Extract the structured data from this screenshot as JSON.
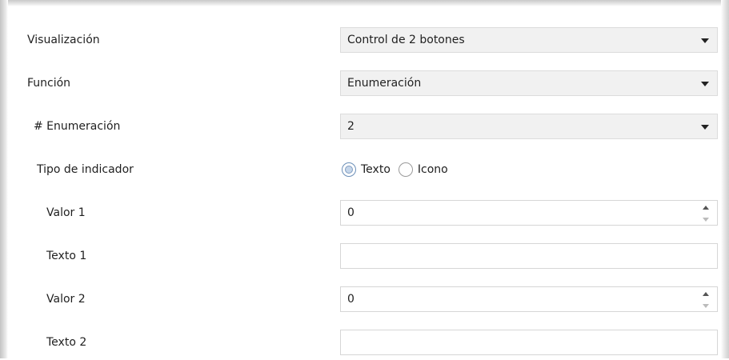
{
  "rows": {
    "visualizacion": {
      "label": "Visualización",
      "value": "Control de 2 botones"
    },
    "funcion": {
      "label": "Función",
      "value": "Enumeración"
    },
    "enumeracion": {
      "label": "# Enumeración",
      "value": "2"
    },
    "tipo_indicador": {
      "label": "Tipo de indicador",
      "options": [
        {
          "label": "Texto",
          "selected": true
        },
        {
          "label": "Icono",
          "selected": false
        }
      ]
    },
    "valor1": {
      "label": "Valor 1",
      "value": "0"
    },
    "texto1": {
      "label": "Texto 1",
      "value": ""
    },
    "valor2": {
      "label": "Valor 2",
      "value": "0"
    },
    "texto2": {
      "label": "Texto 2",
      "value": ""
    }
  },
  "icons": {
    "dropdown": "caret-down-icon",
    "spinner": "spinner-arrows-icon",
    "radio": "radio-button-icon"
  }
}
